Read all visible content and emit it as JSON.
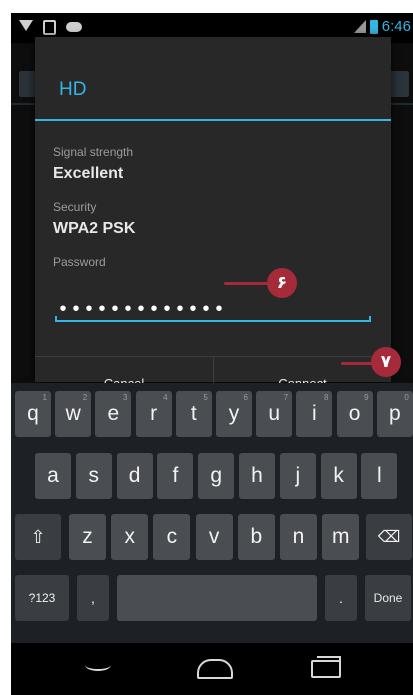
{
  "status_bar": {
    "time": "6:46"
  },
  "dialog": {
    "title": "HD",
    "signal_label": "Signal strength",
    "signal_value": "Excellent",
    "security_label": "Security",
    "security_value": "WPA2 PSK",
    "password_label": "Password",
    "password_value": "•••••••••••••",
    "cancel_label": "Cancel",
    "connect_label": "Connect"
  },
  "callouts": {
    "password": "۶",
    "connect": "۷"
  },
  "keyboard": {
    "row1": [
      "q",
      "w",
      "e",
      "r",
      "t",
      "y",
      "u",
      "i",
      "o",
      "p"
    ],
    "row1_hints": [
      "1",
      "2",
      "3",
      "4",
      "5",
      "6",
      "7",
      "8",
      "9",
      "0"
    ],
    "row2": [
      "a",
      "s",
      "d",
      "f",
      "g",
      "h",
      "j",
      "k",
      "l"
    ],
    "row3": [
      "z",
      "x",
      "c",
      "v",
      "b",
      "n",
      "m"
    ],
    "shift": "⇧",
    "backspace": "⌫",
    "symbols_label": "?123",
    "comma": ",",
    "period": ".",
    "done_label": "Done"
  },
  "colors": {
    "accent": "#33b5e5",
    "callout": "#a52a3a",
    "dialog_bg": "#282828",
    "key_bg": "#4a4e52"
  }
}
